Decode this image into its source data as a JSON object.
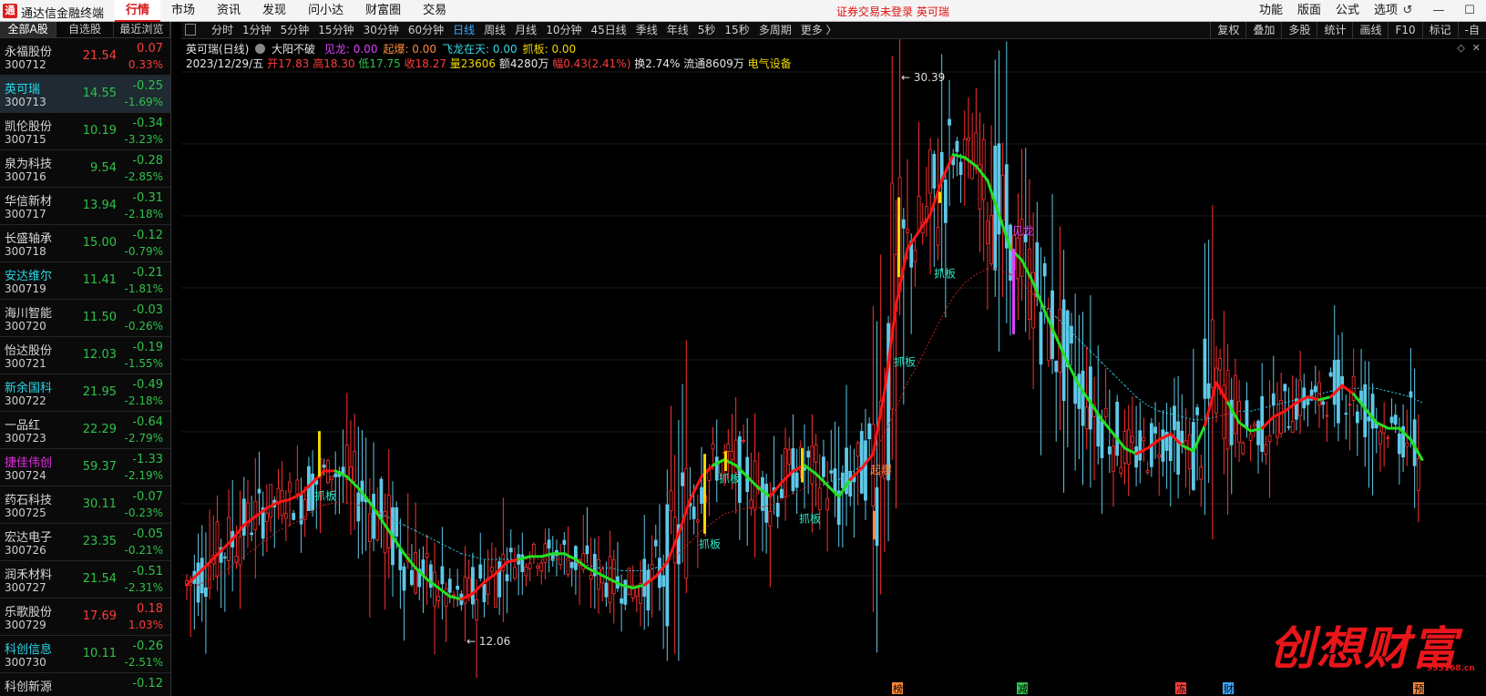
{
  "app": {
    "title": "通达信金融终端",
    "logo_glyph": "通"
  },
  "menu": [
    "行情",
    "市场",
    "资讯",
    "发现",
    "问小达",
    "财富圈",
    "交易"
  ],
  "menu_active": 0,
  "status": "证券交易未登录   英可瑞",
  "right_menu": [
    "功能",
    "版面",
    "公式",
    "选项"
  ],
  "window_controls": [
    "↺",
    "—",
    "☐",
    "✕"
  ],
  "left_tabs": [
    "全部A股",
    "自选股",
    "最近浏览"
  ],
  "stocks": [
    {
      "name": "永福股份",
      "code": "300712",
      "price": "21.54",
      "chg": "0.07",
      "pct": "0.33%",
      "dir": "up",
      "name_color": "white"
    },
    {
      "name": "英可瑞",
      "code": "300713",
      "price": "14.55",
      "chg": "-0.25",
      "pct": "-1.69%",
      "dir": "down",
      "name_color": "cyan",
      "selected": true
    },
    {
      "name": "凯伦股份",
      "code": "300715",
      "price": "10.19",
      "chg": "-0.34",
      "pct": "-3.23%",
      "dir": "down",
      "name_color": "white"
    },
    {
      "name": "泉为科技",
      "code": "300716",
      "price": "9.54",
      "chg": "-0.28",
      "pct": "-2.85%",
      "dir": "down",
      "name_color": "white"
    },
    {
      "name": "华信新材",
      "code": "300717",
      "price": "13.94",
      "chg": "-0.31",
      "pct": "-2.18%",
      "dir": "down",
      "name_color": "white"
    },
    {
      "name": "长盛轴承",
      "code": "300718",
      "price": "15.00",
      "chg": "-0.12",
      "pct": "-0.79%",
      "dir": "down",
      "name_color": "white"
    },
    {
      "name": "安达维尔",
      "code": "300719",
      "price": "11.41",
      "chg": "-0.21",
      "pct": "-1.81%",
      "dir": "down",
      "name_color": "cyan"
    },
    {
      "name": "海川智能",
      "code": "300720",
      "price": "11.50",
      "chg": "-0.03",
      "pct": "-0.26%",
      "dir": "down",
      "name_color": "white"
    },
    {
      "name": "怡达股份",
      "code": "300721",
      "price": "12.03",
      "chg": "-0.19",
      "pct": "-1.55%",
      "dir": "down",
      "name_color": "white"
    },
    {
      "name": "新余国科",
      "code": "300722",
      "price": "21.95",
      "chg": "-0.49",
      "pct": "-2.18%",
      "dir": "down",
      "name_color": "cyan"
    },
    {
      "name": "一品红",
      "code": "300723",
      "price": "22.29",
      "chg": "-0.64",
      "pct": "-2.79%",
      "dir": "down",
      "name_color": "white"
    },
    {
      "name": "捷佳伟创",
      "code": "300724",
      "price": "59.37",
      "chg": "-1.33",
      "pct": "-2.19%",
      "dir": "down",
      "name_color": "magenta"
    },
    {
      "name": "药石科技",
      "code": "300725",
      "price": "30.11",
      "chg": "-0.07",
      "pct": "-0.23%",
      "dir": "down",
      "name_color": "white"
    },
    {
      "name": "宏达电子",
      "code": "300726",
      "price": "23.35",
      "chg": "-0.05",
      "pct": "-0.21%",
      "dir": "down",
      "name_color": "white"
    },
    {
      "name": "润禾材料",
      "code": "300727",
      "price": "21.54",
      "chg": "-0.51",
      "pct": "-2.31%",
      "dir": "down",
      "name_color": "white"
    },
    {
      "name": "乐歌股份",
      "code": "300729",
      "price": "17.69",
      "chg": "0.18",
      "pct": "1.03%",
      "dir": "up",
      "name_color": "white"
    },
    {
      "name": "科创信息",
      "code": "300730",
      "price": "10.11",
      "chg": "-0.26",
      "pct": "-2.51%",
      "dir": "down",
      "name_color": "cyan"
    },
    {
      "name": "科创新源",
      "code": "",
      "price": "",
      "chg": "-0.12",
      "pct": "",
      "dir": "down",
      "name_color": "white"
    }
  ],
  "periods": [
    "分时",
    "1分钟",
    "5分钟",
    "15分钟",
    "30分钟",
    "60分钟",
    "日线",
    "周线",
    "月线",
    "10分钟",
    "45日线",
    "季线",
    "年线",
    "5秒",
    "15秒",
    "多周期",
    "更多 〉"
  ],
  "period_active": 6,
  "tools": [
    "复权",
    "叠加",
    "多股",
    "统计",
    "画线",
    "F10",
    "标记",
    "-自"
  ],
  "indicator": {
    "title": "英可瑞(日线)",
    "name": "大阳不破",
    "items": [
      {
        "label": "见龙: 0.00",
        "color": "mag"
      },
      {
        "label": "起爆: 0.00",
        "color": "org"
      },
      {
        "label": "飞龙在天: 0.00",
        "color": "cyan"
      },
      {
        "label": "抓板: 0.00",
        "color": "yel"
      }
    ]
  },
  "quote": {
    "date": "2023/12/29/五",
    "open": "开17.83",
    "high": "高18.30",
    "low": "低17.75",
    "close": "收18.27",
    "volume": "量23606",
    "amount": "额4280万",
    "range": "幅0.43(2.41%)",
    "turnover": "换2.74%",
    "float": "流通8609万",
    "sector": "电气设备"
  },
  "chart_data": {
    "type": "candlestick",
    "ylim": [
      11.0,
      31.2
    ],
    "price_min_label": "12.06",
    "price_max_label": "30.39",
    "signal_labels": [
      "抓板",
      "抓板",
      "抓板",
      "抓板",
      "抓板",
      "抓板",
      "起爆",
      "见龙"
    ],
    "bottom_markers": [
      {
        "text": "榜",
        "color": "#ff8a3c"
      },
      {
        "text": "减",
        "color": "#2ec24a"
      },
      {
        "text": "冻",
        "color": "#ff3c3c"
      },
      {
        "text": "财",
        "color": "#3fa9ff"
      },
      {
        "text": "预",
        "color": "#ff8a3c"
      }
    ],
    "ma_fast": [
      13.2,
      13.6,
      14.0,
      14.4,
      14.8,
      15.3,
      15.6,
      15.9,
      16.1,
      16.2,
      16.4,
      16.8,
      17.2,
      17.2,
      17.0,
      16.6,
      16.1,
      15.5,
      14.9,
      14.3,
      13.8,
      13.4,
      13.1,
      12.8,
      12.7,
      12.9,
      13.3,
      13.6,
      14.0,
      14.1,
      14.2,
      14.2,
      14.3,
      14.3,
      14.1,
      13.8,
      13.6,
      13.4,
      13.2,
      13.1,
      13.2,
      13.5,
      14.0,
      15.0,
      16.2,
      17.0,
      17.4,
      17.6,
      17.4,
      17.0,
      16.6,
      16.3,
      16.8,
      17.2,
      17.4,
      17.1,
      16.7,
      16.3,
      16.9,
      17.3,
      17.8,
      20.0,
      23.0,
      25.0,
      25.6,
      26.2,
      27.4,
      28.3,
      28.2,
      27.9,
      27.4,
      26.2,
      25.0,
      24.6,
      23.8,
      22.8,
      21.9,
      21.0,
      20.2,
      19.6,
      19.0,
      18.5,
      18.0,
      17.8,
      18.0,
      18.3,
      18.5,
      18.1,
      17.9,
      18.8,
      20.3,
      19.6,
      18.9,
      18.6,
      18.7,
      19.1,
      19.3,
      19.6,
      19.8,
      19.7,
      19.8,
      20.2,
      19.9,
      19.4,
      18.9,
      18.7,
      18.7,
      18.3,
      17.6
    ],
    "ma_slow": [
      13.0,
      13.2,
      13.4,
      13.6,
      13.9,
      14.2,
      14.5,
      14.8,
      15.1,
      15.3,
      15.5,
      15.8,
      16.0,
      16.1,
      16.1,
      16.0,
      15.9,
      15.7,
      15.5,
      15.3,
      15.1,
      14.9,
      14.7,
      14.5,
      14.3,
      14.2,
      14.1,
      14.1,
      14.1,
      14.1,
      14.1,
      14.1,
      14.1,
      14.1,
      14.0,
      13.9,
      13.8,
      13.8,
      13.7,
      13.7,
      13.7,
      13.8,
      14.0,
      14.3,
      14.7,
      15.1,
      15.4,
      15.7,
      15.8,
      15.9,
      15.9,
      16.0,
      16.2,
      16.4,
      16.6,
      16.7,
      16.8,
      16.9,
      17.1,
      17.4,
      17.8,
      18.5,
      19.4,
      20.3,
      21.0,
      21.8,
      22.6,
      23.3,
      23.8,
      24.1,
      24.3,
      24.3,
      24.1,
      23.8,
      23.4,
      23.0,
      22.6,
      22.2,
      21.8,
      21.4,
      21.0,
      20.6,
      20.2,
      19.8,
      19.5,
      19.3,
      19.2,
      19.1,
      19.0,
      19.0,
      19.1,
      19.2,
      19.3,
      19.3,
      19.4,
      19.5,
      19.6,
      19.7,
      19.8,
      19.9,
      20.0,
      20.1,
      20.1,
      20.1,
      20.1,
      20.0,
      19.9,
      19.8,
      19.6
    ],
    "ma_trend": [
      "r",
      "r",
      "r",
      "r",
      "r",
      "r",
      "r",
      "r",
      "r",
      "r",
      "r",
      "r",
      "r",
      "g",
      "g",
      "g",
      "g",
      "g",
      "g",
      "g",
      "g",
      "g",
      "g",
      "g",
      "r",
      "r",
      "r",
      "r",
      "r",
      "g",
      "g",
      "g",
      "g",
      "g",
      "g",
      "g",
      "g",
      "g",
      "g",
      "g",
      "r",
      "r",
      "r",
      "r",
      "r",
      "r",
      "g",
      "g",
      "g",
      "g",
      "g",
      "r",
      "r",
      "r",
      "g",
      "g",
      "g",
      "g",
      "r",
      "r",
      "r",
      "r",
      "r",
      "r",
      "r",
      "r",
      "r",
      "g",
      "g",
      "g",
      "g",
      "g",
      "g",
      "g",
      "g",
      "g",
      "g",
      "g",
      "g",
      "g",
      "g",
      "g",
      "g",
      "r",
      "r",
      "r",
      "r",
      "g",
      "g",
      "r",
      "r",
      "g",
      "g",
      "g",
      "r",
      "r",
      "r",
      "r",
      "r",
      "g",
      "r",
      "r",
      "g",
      "g",
      "g",
      "g",
      "g",
      "g",
      "g"
    ]
  },
  "watermark": {
    "text": "创想财富",
    "sub": "995168.cn"
  }
}
